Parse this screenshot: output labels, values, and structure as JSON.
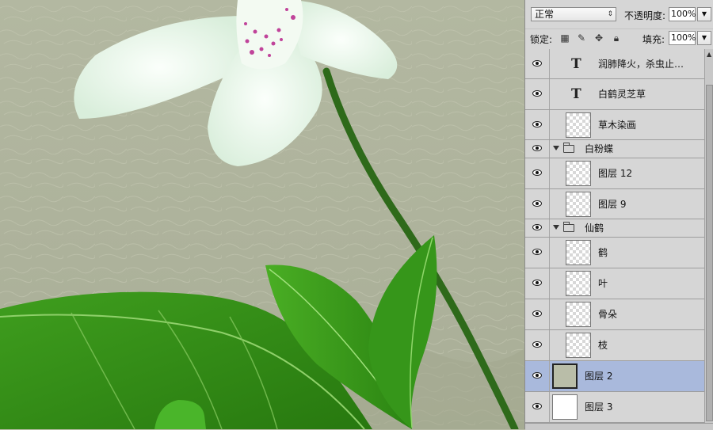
{
  "panel": {
    "blend_mode": "正常",
    "opacity_label": "不透明度:",
    "opacity_value": "100%",
    "lock_label": "锁定:",
    "fill_label": "填充:",
    "fill_value": "100%",
    "lock_icons": [
      "lock-transparent-icon",
      "lock-brush-icon",
      "lock-move-icon",
      "lock-all-icon"
    ]
  },
  "layers": [
    {
      "name": "润肺降火，杀虫止…",
      "type": "text"
    },
    {
      "name": "白鹤灵芝草",
      "type": "text"
    },
    {
      "name": "草木染画",
      "type": "image"
    },
    {
      "name": "白粉蝶",
      "type": "group"
    },
    {
      "name": "图层 12",
      "type": "image"
    },
    {
      "name": "图层 9",
      "type": "image"
    },
    {
      "name": "仙鹤",
      "type": "group"
    },
    {
      "name": "鹤",
      "type": "image"
    },
    {
      "name": "叶",
      "type": "image"
    },
    {
      "name": "骨朵",
      "type": "image"
    },
    {
      "name": "枝",
      "type": "image"
    },
    {
      "name": "图层 2",
      "type": "image",
      "selected": true
    },
    {
      "name": "图层 3",
      "type": "image"
    }
  ],
  "colors": {
    "canvas_bg": "#b5b9a3",
    "leaf": "#2f8a14",
    "petal": "#eef6ee",
    "selected_row": "#a9b9dc"
  }
}
